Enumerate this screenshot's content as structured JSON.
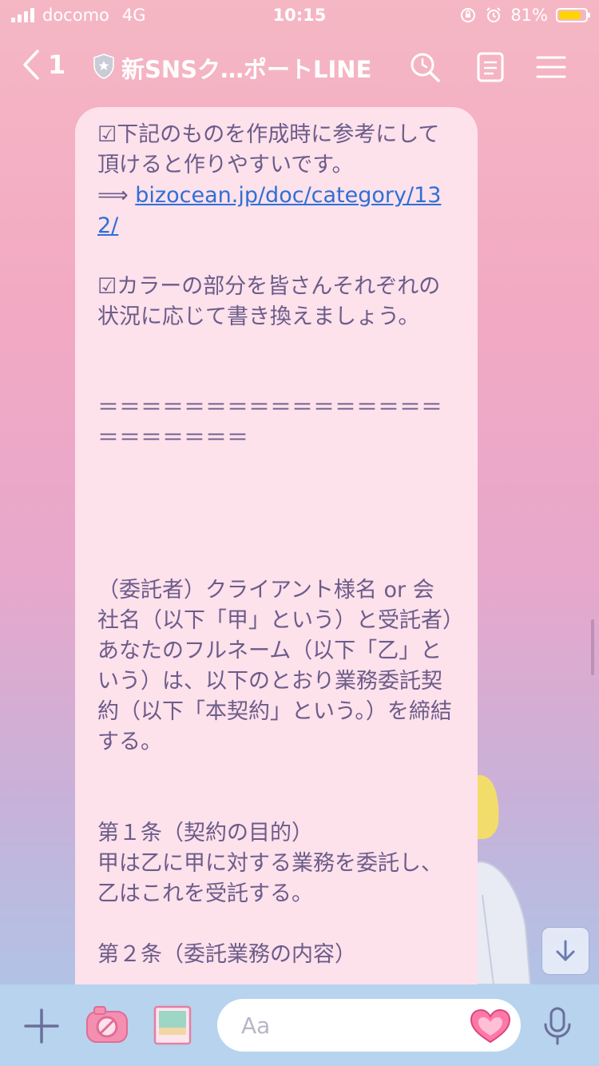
{
  "status_bar": {
    "carrier": "docomo",
    "network": "4G",
    "time": "10:15",
    "battery_percent": "81%",
    "battery_color": "#ffd400"
  },
  "header": {
    "back_count": "1",
    "title": "新SNSク…ポートLINE",
    "icons": [
      "shield-icon",
      "search-icon",
      "notes-icon",
      "menu-icon"
    ]
  },
  "message": {
    "line1": "☑下記のものを作成時に参考にして頂けると作りやすいです。",
    "arrow": "⟹ ",
    "link": "bizocean.jp/doc/category/132/",
    "line2": "☑カラーの部分を皆さんそれぞれの状況に応じて書き換えましょう。",
    "separator": "＝＝＝＝＝＝＝＝＝＝＝＝＝＝＝＝＝＝＝＝＝＝＝",
    "paragraph": "（委託者）クライアント様名 or 会社名（以下「甲」という）と受託者）あなたのフルネーム（以下「乙」という）は、以下のとおり業務委託契約（以下「本契約」という。）を締結する。",
    "article1_title": "第１条（契約の目的）",
    "article1_body": "甲は乙に甲に対する業務を委託し、乙はこれを受託する。",
    "article2_title": "第２条（委託業務の内容）"
  },
  "input_bar": {
    "placeholder": "Aa",
    "icons": [
      "plus-icon",
      "camera-icon",
      "photo-icon",
      "heart-emoji-icon",
      "mic-icon"
    ]
  },
  "colors": {
    "bubble": "#fde1eb",
    "text": "#6c5c8a",
    "link": "#2f6fd6",
    "input_bar": "#b7d3ee"
  }
}
